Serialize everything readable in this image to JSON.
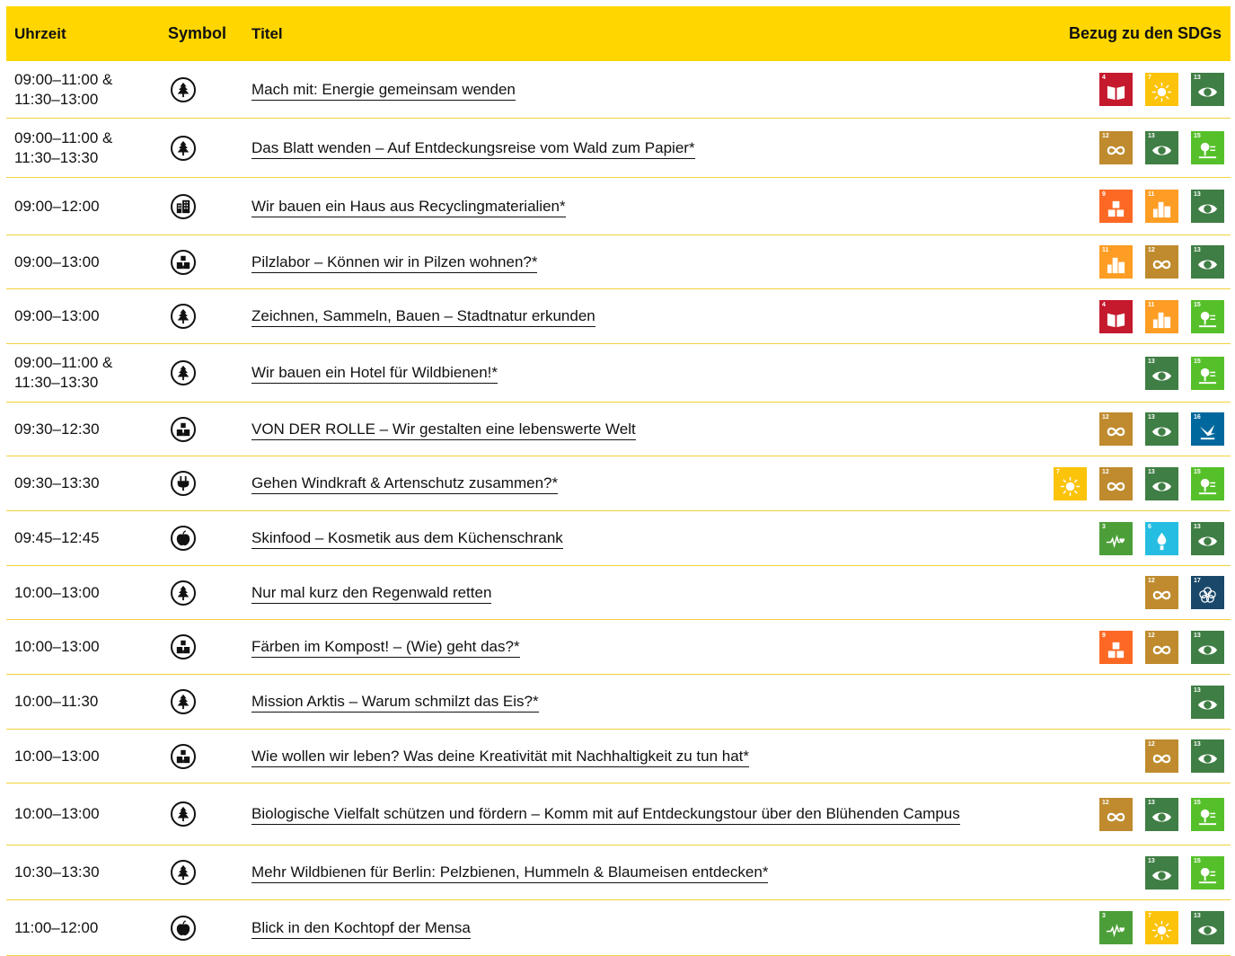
{
  "header": {
    "time": "Uhrzeit",
    "symbol": "Symbol",
    "title": "Titel",
    "sdgs": "Bezug zu den SDGs"
  },
  "sdg_colors": {
    "3": "#4c9f38",
    "4": "#c5192d",
    "6": "#26bde2",
    "7": "#fcc30b",
    "9": "#fd6925",
    "11": "#fd9d24",
    "12": "#bf8b2e",
    "13": "#3f7e44",
    "15": "#56c02b",
    "16": "#00689d",
    "17": "#19486a"
  },
  "rows": [
    {
      "time1": "09:00–11:00 &",
      "time2": "11:30–13:00",
      "symbol": "tree-icon",
      "title": "Mach mit: Energie gemeinsam wenden",
      "sdgs": [
        "4",
        "7",
        "13"
      ]
    },
    {
      "time1": "09:00–11:00 &",
      "time2": "11:30–13:30",
      "symbol": "tree-icon",
      "title": "Das Blatt wenden – Auf Entdeckungsreise vom Wald zum Papier*",
      "sdgs": [
        "12",
        "13",
        "15"
      ]
    },
    {
      "time1": "09:00–12:00",
      "time2": "",
      "symbol": "city-icon",
      "title": "Wir bauen ein Haus aus Recyclingmaterialien*",
      "sdgs": [
        "9",
        "11",
        "13"
      ]
    },
    {
      "time1": "09:00–13:00",
      "time2": "",
      "symbol": "blocks-icon",
      "title": "Pilzlabor – Können wir in Pilzen wohnen?*",
      "sdgs": [
        "11",
        "12",
        "13"
      ]
    },
    {
      "time1": "09:00–13:00",
      "time2": "",
      "symbol": "tree-icon",
      "title": "Zeichnen, Sammeln, Bauen – Stadtnatur erkunden",
      "sdgs": [
        "4",
        "11",
        "15"
      ]
    },
    {
      "time1": "09:00–11:00 &",
      "time2": "11:30–13:30",
      "symbol": "tree-icon",
      "title": "Wir bauen ein Hotel für Wildbienen!*",
      "sdgs": [
        "13",
        "15"
      ]
    },
    {
      "time1": "09:30–12:30",
      "time2": "",
      "symbol": "blocks-icon",
      "title": "VON DER ROLLE – Wir gestalten eine lebenswerte Welt",
      "sdgs": [
        "12",
        "13",
        "16"
      ]
    },
    {
      "time1": "09:30–13:30",
      "time2": "",
      "symbol": "plug-icon",
      "title": "Gehen Windkraft & Artenschutz zusammen?*",
      "sdgs": [
        "7",
        "12",
        "13",
        "15"
      ]
    },
    {
      "time1": "09:45–12:45",
      "time2": "",
      "symbol": "apple-icon",
      "title": "Skinfood – Kosmetik aus dem Küchenschrank",
      "sdgs": [
        "3",
        "6",
        "13"
      ]
    },
    {
      "time1": "10:00–13:00",
      "time2": "",
      "symbol": "tree-icon",
      "title": "Nur mal kurz den Regenwald retten",
      "sdgs": [
        "12",
        "17"
      ]
    },
    {
      "time1": "10:00–13:00",
      "time2": "",
      "symbol": "blocks-icon",
      "title": "Färben im Kompost! – (Wie) geht das?*",
      "sdgs": [
        "9",
        "12",
        "13"
      ]
    },
    {
      "time1": "10:00–11:30",
      "time2": "",
      "symbol": "tree-icon",
      "title": "Mission Arktis – Warum schmilzt das Eis?*",
      "sdgs": [
        "13"
      ]
    },
    {
      "time1": "10:00–13:00",
      "time2": "",
      "symbol": "blocks-icon",
      "title": "Wie wollen wir leben? Was deine Kreativität mit Nachhaltigkeit zu tun hat*",
      "sdgs": [
        "12",
        "13"
      ]
    },
    {
      "time1": "10:00–13:00",
      "time2": "",
      "symbol": "tree-icon",
      "title": "Biologische Vielfalt schützen und fördern – Komm mit auf Entdeckungstour über den Blühenden Campus",
      "sdgs": [
        "12",
        "13",
        "15"
      ]
    },
    {
      "time1": "10:30–13:30",
      "time2": "",
      "symbol": "tree-icon",
      "title": "Mehr Wildbienen für Berlin: Pelzbienen, Hummeln & Blaumeisen entdecken*",
      "sdgs": [
        "13",
        "15"
      ]
    },
    {
      "time1": "11:00–12:00",
      "time2": "",
      "symbol": "apple-icon",
      "title": "Blick in den Kochtopf der Mensa",
      "sdgs": [
        "3",
        "7",
        "13"
      ]
    }
  ]
}
